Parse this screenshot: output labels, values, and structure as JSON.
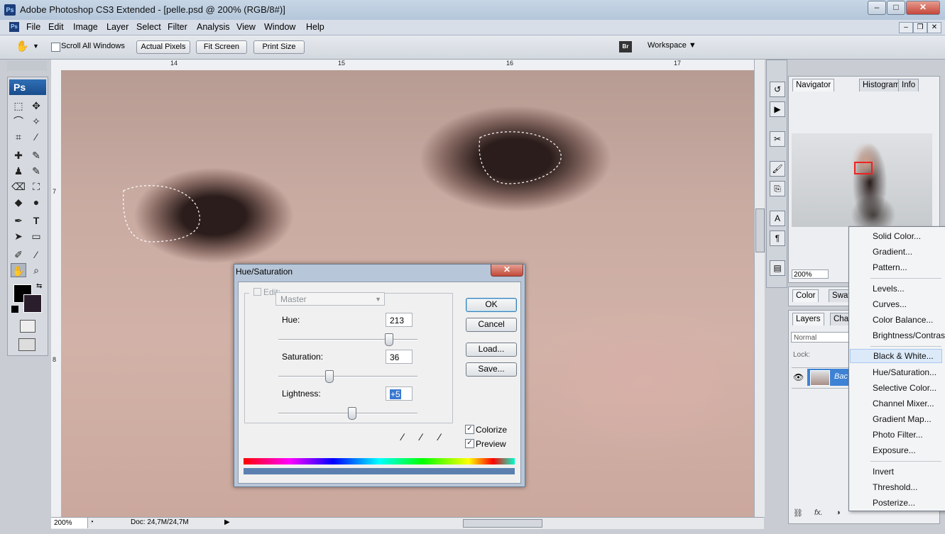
{
  "window": {
    "title": "Adobe Photoshop CS3 Extended - [pelle.psd @ 200% (RGB/8#)]",
    "app_icon": "Ps",
    "btn_minimize": "–",
    "btn_maximize": "□",
    "btn_close": "✕"
  },
  "menu": {
    "items": [
      "File",
      "Edit",
      "Image",
      "Layer",
      "Select",
      "Filter",
      "Analysis",
      "View",
      "Window",
      "Help"
    ],
    "mdi_minimize": "–",
    "mdi_restore": "❐",
    "mdi_close": "✕"
  },
  "options_bar": {
    "scroll_all_windows": "Scroll All Windows",
    "actual_pixels": "Actual Pixels",
    "fit_screen": "Fit Screen",
    "print_size": "Print Size",
    "workspace": "Workspace ▼",
    "bridge_icon": "Br"
  },
  "toolbox": {
    "logo": "Ps",
    "icons": [
      "⬚",
      "✥",
      "⌒",
      "✧",
      "⌗",
      "⁄",
      "✚",
      "✎",
      "♟",
      "✎",
      "⌫",
      "⛶",
      "◆",
      "●",
      "✒",
      "T",
      "➤",
      "▭",
      "✐",
      "⁄",
      "✋",
      "⌕"
    ]
  },
  "ruler": {
    "top_ticks": [
      "14",
      "15",
      "16",
      "17"
    ],
    "left_ticks": [
      "7",
      "8"
    ]
  },
  "status_bar": {
    "zoom": "200%",
    "doc": "Doc: 24,7M/24,7M"
  },
  "navigator": {
    "tabs": [
      "Navigator",
      "Histogram",
      "Info"
    ],
    "zoom": "200%"
  },
  "color_panel": {
    "tabs": [
      "Color",
      "Swatch"
    ]
  },
  "layers_panel": {
    "tabs": [
      "Layers",
      "Cha"
    ],
    "blend_mode": "Normal",
    "lock_label": "Lock:",
    "layer_name": "Bac",
    "bottom_icons": [
      "⛓",
      "fx.",
      "◑",
      "▢",
      "▭",
      "🗑"
    ]
  },
  "context_menu": {
    "items": [
      {
        "label": "Solid Color..."
      },
      {
        "label": "Gradient..."
      },
      {
        "label": "Pattern..."
      },
      {
        "label": "Levels..."
      },
      {
        "label": "Curves..."
      },
      {
        "label": "Color Balance..."
      },
      {
        "label": "Brightness/Contrast"
      },
      {
        "label": "Black & White..."
      },
      {
        "label": "Hue/Saturation..."
      },
      {
        "label": "Selective Color..."
      },
      {
        "label": "Channel Mixer..."
      },
      {
        "label": "Gradient Map..."
      },
      {
        "label": "Photo Filter..."
      },
      {
        "label": "Exposure..."
      },
      {
        "label": "Invert"
      },
      {
        "label": "Threshold..."
      },
      {
        "label": "Posterize..."
      }
    ]
  },
  "dialog": {
    "title": "Hue/Saturation",
    "close": "✕",
    "edit_label": "Edit:",
    "edit_value": "Master",
    "hue_label": "Hue:",
    "hue_value": "213",
    "saturation_label": "Saturation:",
    "saturation_value": "36",
    "lightness_label": "Lightness:",
    "lightness_value": "+5",
    "hue_fraction": 0.79,
    "saturation_fraction": 0.36,
    "lightness_fraction": 0.525,
    "ok": "OK",
    "cancel": "Cancel",
    "load": "Load...",
    "save": "Save...",
    "colorize_label": "Colorize",
    "colorize_checked": true,
    "preview_label": "Preview",
    "preview_checked": true
  }
}
